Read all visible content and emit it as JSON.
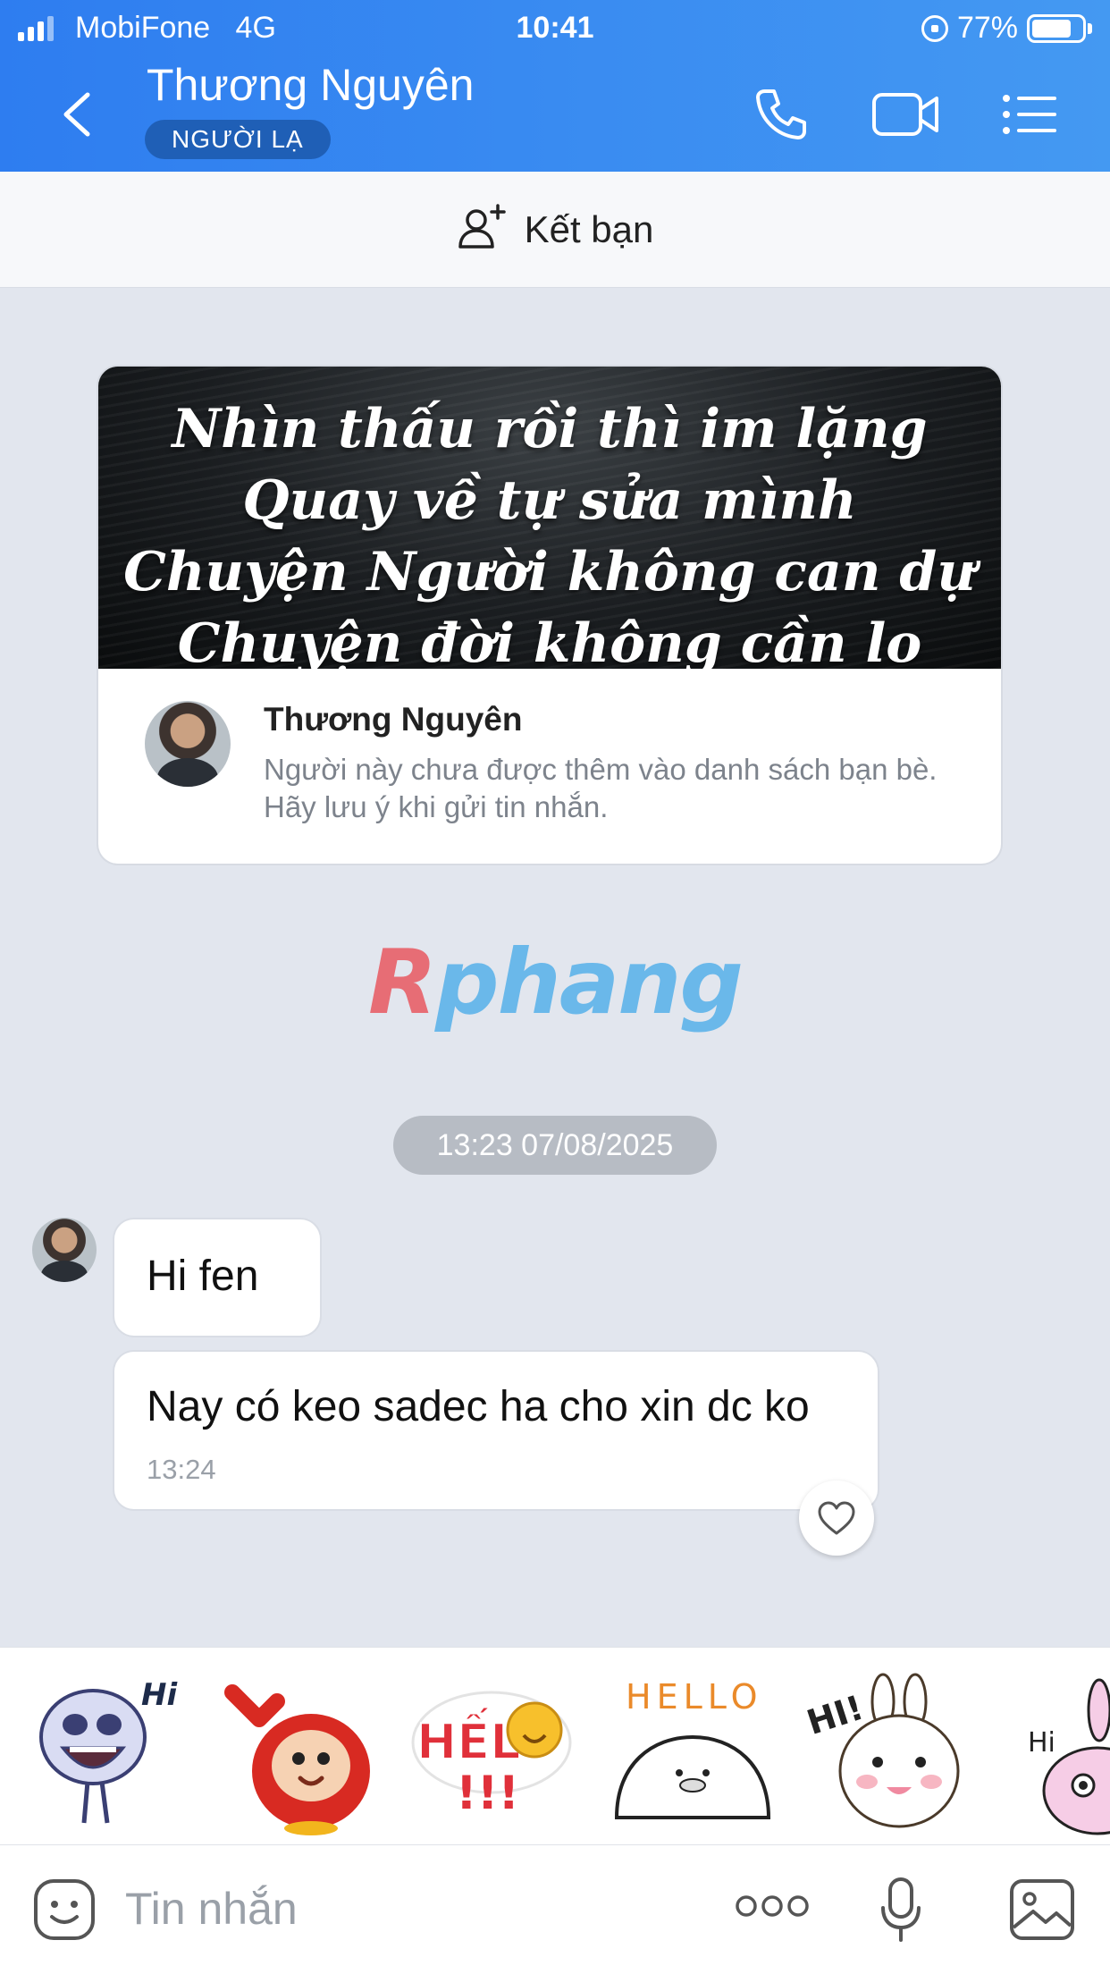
{
  "status_bar": {
    "carrier": "MobiFone",
    "network": "4G",
    "time": "10:41",
    "battery": "77%"
  },
  "header": {
    "contact_name": "Thương Nguyên",
    "badge": "NGƯỜI LẠ",
    "icons": [
      "back-icon",
      "phone-icon",
      "video-call-icon",
      "menu-list-icon"
    ]
  },
  "add_friend": {
    "label": "Kết bạn",
    "icon": "add-user-icon"
  },
  "profile_card": {
    "cover_quote": [
      "Nhìn thấu rồi thì im lặng",
      "Quay về tự sửa mình",
      "Chuyện Người không can dự",
      "Chuyện đời không cần lo"
    ],
    "name": "Thương Nguyên",
    "note": "Người này chưa được thêm vào danh sách bạn bè. Hãy lưu ý khi gửi tin nhắn."
  },
  "watermark": {
    "first_letter": "R",
    "rest": "phang"
  },
  "chat": {
    "date_separator": "13:23 07/08/2025",
    "messages": [
      {
        "text": "Hi fen"
      },
      {
        "text": "Nay có keo sadec ha cho xin dc ko",
        "time": "13:24"
      }
    ]
  },
  "stickers": {
    "items": [
      {
        "name": "skeleton-hi-sticker",
        "text": "Hi"
      },
      {
        "name": "red-monkey-wave-sticker",
        "text": ""
      },
      {
        "name": "helo-smiley-sticker",
        "text": "HẾL"
      },
      {
        "name": "hello-blob-sticker",
        "text": "HELLO"
      },
      {
        "name": "bunny-hi-sticker",
        "text": "HI!"
      },
      {
        "name": "pink-bunny-hi-sticker",
        "text": "Hi"
      }
    ]
  },
  "composer": {
    "placeholder": "Tin nhắn",
    "icons": [
      "emoji-icon",
      "more-icon",
      "microphone-icon",
      "image-icon"
    ]
  },
  "colors": {
    "header": "#3a8df2",
    "badge": "#1f5fb6",
    "background": "#e2e6ee",
    "bubble": "#ffffff"
  }
}
